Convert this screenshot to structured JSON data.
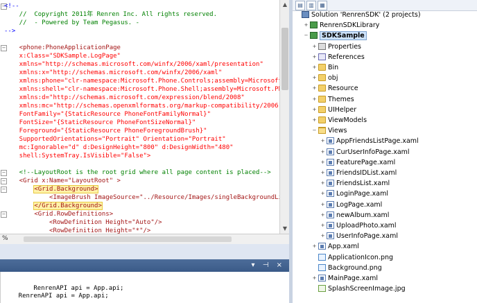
{
  "editor": {
    "lines": [
      {
        "cls": "c-bl",
        "text": "<!--"
      },
      {
        "cls": "c-cm",
        "text": "    //  Copyright 2011年 Renren Inc. All rights reserved."
      },
      {
        "cls": "c-cm",
        "text": "    //  - Powered by Team Pegasus. -"
      },
      {
        "cls": "c-bl",
        "text": "-->"
      },
      {
        "cls": "c-bl",
        "text": ""
      },
      {
        "cls": "c-mr",
        "text": "    <phone:PhoneApplicationPage"
      },
      {
        "cls": "c-rd",
        "text": "    x:Class=\"SDKSample.LogPage\""
      },
      {
        "cls": "c-rd",
        "text": "    xmlns=\"http://schemas.microsoft.com/winfx/2006/xaml/presentation\""
      },
      {
        "cls": "c-rd",
        "text": "    xmlns:x=\"http://schemas.microsoft.com/winfx/2006/xaml\""
      },
      {
        "cls": "c-rd",
        "text": "    xmlns:phone=\"clr-namespace:Microsoft.Phone.Controls;assembly=Microsoft.I"
      },
      {
        "cls": "c-rd",
        "text": "    xmlns:shell=\"clr-namespace:Microsoft.Phone.Shell;assembly=Microsoft.Phon"
      },
      {
        "cls": "c-rd",
        "text": "    xmlns:d=\"http://schemas.microsoft.com/expression/blend/2008\""
      },
      {
        "cls": "c-rd",
        "text": "    xmlns:mc=\"http://schemas.openxmlformats.org/markup-compatibility/2006\""
      },
      {
        "cls": "c-rd",
        "text": "    FontFamily=\"{StaticResource PhoneFontFamilyNormal}\""
      },
      {
        "cls": "c-rd",
        "text": "    FontSize=\"{StaticResource PhoneFontSizeNormal}\""
      },
      {
        "cls": "c-rd",
        "text": "    Foreground=\"{StaticResource PhoneForegroundBrush}\""
      },
      {
        "cls": "c-rd",
        "text": "    SupportedOrientations=\"Portrait\" Orientation=\"Portrait\""
      },
      {
        "cls": "c-rd",
        "text": "    mc:Ignorable=\"d\" d:DesignHeight=\"800\" d:DesignWidth=\"480\""
      },
      {
        "cls": "c-rd",
        "text": "    shell:SystemTray.IsVisible=\"False\">"
      },
      {
        "cls": "c-bl",
        "text": ""
      },
      {
        "cls": "c-cm",
        "text": "    <!--LayoutRoot is the root grid where all page content is placed-->"
      },
      {
        "cls": "c-mr",
        "text": "    <Grid x:Name=\"LayoutRoot\" >"
      },
      {
        "cls": "c-mr hl-line",
        "text": "        <Grid.Background>"
      },
      {
        "cls": "c-mr",
        "text": "            <ImageBrush ImageSource=\"../Resource/Images/singleBackgroundLig"
      },
      {
        "cls": "c-mr hl-line",
        "text": "        </Grid.Background>"
      },
      {
        "cls": "c-mr",
        "text": "        <Grid.RowDefinitions>"
      },
      {
        "cls": "c-mr",
        "text": "            <RowDefinition Height=\"Auto\"/>"
      },
      {
        "cls": "c-mr",
        "text": "            <RowDefinition Height=\"*\"/>"
      }
    ],
    "zoom": "%"
  },
  "output": {
    "lines": [
      "        RenrenAPI api = App.api;",
      "    RenrenAPI api = App.api;"
    ]
  },
  "panel": {
    "icons": "▾ ⊣ ×"
  },
  "explorer": {
    "toolbar": [
      "▤",
      "▥",
      "▦"
    ],
    "tree": [
      {
        "indent": 0,
        "exp": "",
        "icon": "sol",
        "label": "Solution 'RenrenSDK' (2 projects)"
      },
      {
        "indent": 1,
        "exp": "+",
        "icon": "proj",
        "label": "RenrenSDKLibrary"
      },
      {
        "indent": 1,
        "exp": "−",
        "icon": "proj",
        "label": "SDKSample",
        "sel": true
      },
      {
        "indent": 2,
        "exp": "+",
        "icon": "props",
        "label": "Properties"
      },
      {
        "indent": 2,
        "exp": "+",
        "icon": "refs",
        "label": "References"
      },
      {
        "indent": 2,
        "exp": "+",
        "icon": "folder",
        "label": "Bin"
      },
      {
        "indent": 2,
        "exp": "+",
        "icon": "folder",
        "label": "obj"
      },
      {
        "indent": 2,
        "exp": "+",
        "icon": "folder",
        "label": "Resource"
      },
      {
        "indent": 2,
        "exp": "+",
        "icon": "folder",
        "label": "Themes"
      },
      {
        "indent": 2,
        "exp": "+",
        "icon": "folder",
        "label": "UIHelper"
      },
      {
        "indent": 2,
        "exp": "+",
        "icon": "folder",
        "label": "ViewModels"
      },
      {
        "indent": 2,
        "exp": "−",
        "icon": "folder-open",
        "label": "Views"
      },
      {
        "indent": 3,
        "exp": "+",
        "icon": "xaml",
        "label": "AppFriendsListPage.xaml"
      },
      {
        "indent": 3,
        "exp": "+",
        "icon": "xaml",
        "label": "CurUserInfoPage.xaml"
      },
      {
        "indent": 3,
        "exp": "+",
        "icon": "xaml",
        "label": "FeaturePage.xaml"
      },
      {
        "indent": 3,
        "exp": "+",
        "icon": "xaml",
        "label": "FriendsIDList.xaml"
      },
      {
        "indent": 3,
        "exp": "+",
        "icon": "xaml",
        "label": "FriendsList.xaml"
      },
      {
        "indent": 3,
        "exp": "+",
        "icon": "xaml",
        "label": "LoginPage.xaml"
      },
      {
        "indent": 3,
        "exp": "+",
        "icon": "xaml",
        "label": "LogPage.xaml"
      },
      {
        "indent": 3,
        "exp": "+",
        "icon": "xaml",
        "label": "newAlbum.xaml"
      },
      {
        "indent": 3,
        "exp": "+",
        "icon": "xaml",
        "label": "UploadPhoto.xaml"
      },
      {
        "indent": 3,
        "exp": "+",
        "icon": "xaml",
        "label": "UserInfoPage.xaml"
      },
      {
        "indent": 2,
        "exp": "+",
        "icon": "xaml",
        "label": "App.xaml"
      },
      {
        "indent": 2,
        "exp": "",
        "icon": "png",
        "label": "ApplicationIcon.png"
      },
      {
        "indent": 2,
        "exp": "",
        "icon": "png",
        "label": "Background.png"
      },
      {
        "indent": 2,
        "exp": "+",
        "icon": "xaml",
        "label": "MainPage.xaml"
      },
      {
        "indent": 2,
        "exp": "",
        "icon": "jpg",
        "label": "SplashScreenImage.jpg"
      }
    ]
  }
}
